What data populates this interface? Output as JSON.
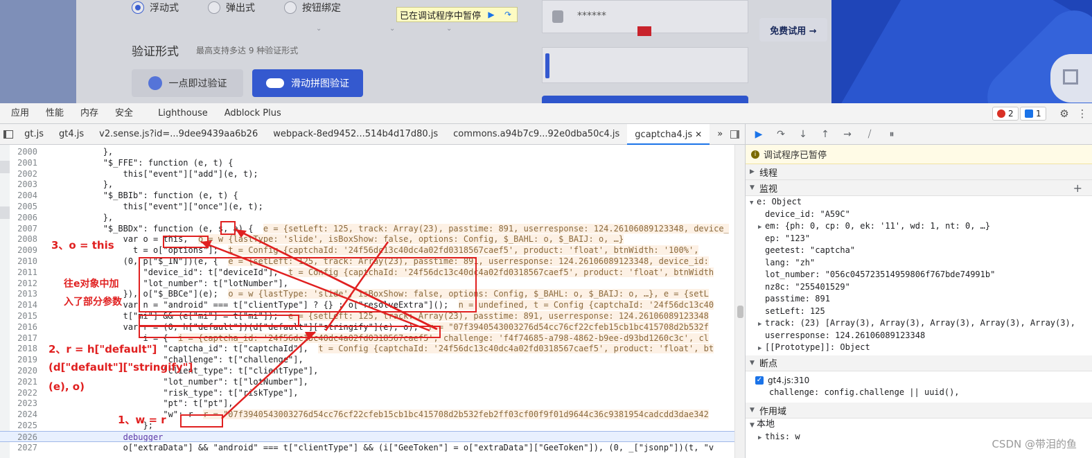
{
  "page": {
    "radio_options": [
      {
        "label": "浮动式",
        "selected": true
      },
      {
        "label": "弹出式",
        "selected": false
      },
      {
        "label": "按钮绑定",
        "selected": false
      }
    ],
    "section_title": "验证形式",
    "section_subtitle": "最高支持多达 9 种验证形式",
    "btn_one_click": "一点即过验证",
    "btn_slide": "滑动拼图验证",
    "paused_banner": "已在调试程序中暂停",
    "password_mask": "******",
    "free_trial": "免费试用 →",
    "accent_color": "#3459cf"
  },
  "devtools": {
    "panel_tabs": [
      "应用",
      "性能",
      "内存",
      "安全",
      "Lighthouse",
      "Adblock Plus"
    ],
    "error_count": "2",
    "message_count": "1",
    "file_tabs": [
      "gt.js",
      "gt4.js",
      "v2.sense.js?id=...9dee9439aa6b26",
      "webpack-8ed9452...514b4d17d80.js",
      "commons.a94b7c9...92e0dba50c4.js",
      "gcaptcha4.js"
    ],
    "active_file_tab": "gcaptcha4.js",
    "code_lines": [
      {
        "num": "2000",
        "code": "            },",
        "inline": ""
      },
      {
        "num": "2001",
        "code": "            \"$_FFE\": function (e, t) {",
        "inline": ""
      },
      {
        "num": "2002",
        "code": "                this[\"event\"][\"add\"](e, t);",
        "inline": ""
      },
      {
        "num": "2003",
        "code": "            },",
        "inline": ""
      },
      {
        "num": "2004",
        "code": "            \"$_BBIb\": function (e, t) {",
        "inline": ""
      },
      {
        "num": "2005",
        "code": "                this[\"event\"][\"once\"](e, t);",
        "inline": ""
      },
      {
        "num": "2006",
        "code": "            },",
        "inline": ""
      },
      {
        "num": "2007",
        "code": "            \"$_BBDx\": function (e, s, a) {  ",
        "inline": "e = {setLeft: 125, track: Array(23), passtime: 891, userresponse: 124.26106089123348, device_"
      },
      {
        "num": "2008",
        "code": "                var o = this,  ",
        "inline": "o = w {lastType: 'slide', isBoxShow: false, options: Config, $_BAHL: o, $_BAIJ: o, …}"
      },
      {
        "num": "2009",
        "code": "                  t = o[\"options\"];  ",
        "inline": "t = Config {captchaId: '24f56dc13c40dc4a02fd0318567caef5', product: 'float', btnWidth: '100%',"
      },
      {
        "num": "2010",
        "code": "                (0, p[\"$_IN\"])(e, {  ",
        "inline": "e = {setLeft: 125, track: Array(23), passtime: 891, userresponse: 124.26106089123348, device_id:"
      },
      {
        "num": "2011",
        "code": "                    \"device_id\": t[\"deviceId\"],  ",
        "inline": "t = Config {captchaId: '24f56dc13c40dc4a02fd0318567caef5', product: 'float', btnWidth"
      },
      {
        "num": "2012",
        "code": "                    \"lot_number\": t[\"lotNumber\"],",
        "inline": ""
      },
      {
        "num": "2013",
        "code": "                }), o[\"$_BBCe\"](e);  ",
        "inline": "o = w {lastType: 'slide', isBoxShow: false, options: Config, $_BAHL: o, $_BAIJ: o, …}, e = {setL"
      },
      {
        "num": "2014",
        "code": "                var n = \"android\" === t[\"clientType\"] ? {} : o[\"resolveExtra\"]();  ",
        "inline": "n = undefined, t = Config {captchaId: '24f56dc13c40"
      },
      {
        "num": "2015",
        "code": "                t[\"mi\"] && (e[\"mi\"] = t[\"mi\"]);  ",
        "inline": "e = {setLeft: 125, track: Array(23), passtime: 891, userresponse: 124.26106089123348"
      },
      {
        "num": "2016",
        "code": "                var r = (0, h[\"default\"])(d[\"default\"][\"stringify\"](e), o),  ",
        "inline": "r = \"07f3940543003276d54cc76cf22cfeb15cb1bc415708d2b532f"
      },
      {
        "num": "2017",
        "code": "                    i = {  ",
        "inline": "i = {captcha_id: '24f56dc13c40dc4a02fd0318567caef5', challenge: 'f4f74685-a798-4862-b9ee-d93bd1260c3c', cl"
      },
      {
        "num": "2018",
        "code": "                        \"captcha_id\": t[\"captchaId\"],  ",
        "inline": "t = Config {captchaId: '24f56dc13c40dc4a02fd0318567caef5', product: 'float', bt"
      },
      {
        "num": "2019",
        "code": "                        \"challenge\": t[\"challenge\"],",
        "inline": ""
      },
      {
        "num": "2020",
        "code": "                        \"client_type\": t[\"clientType\"],",
        "inline": ""
      },
      {
        "num": "2021",
        "code": "                        \"lot_number\": t[\"lotNumber\"],",
        "inline": ""
      },
      {
        "num": "2022",
        "code": "                        \"risk_type\": t[\"riskType\"],",
        "inline": ""
      },
      {
        "num": "2023",
        "code": "                        \"pt\": t[\"pt\"],",
        "inline": ""
      },
      {
        "num": "2024",
        "code": "                        \"w\": r  ",
        "inline": "r = \"07f3940543003276d54cc76cf22cfeb15cb1bc415708d2b532feb2ff03cf00f9f01d9644c36c9381954cadcdd3dae342"
      },
      {
        "num": "2025",
        "code": "                    };",
        "inline": ""
      },
      {
        "num": "2026",
        "code": "                debugger",
        "inline": ""
      },
      {
        "num": "2027",
        "code": "                o[\"extraData\"] && \"android\" === t[\"clientType\"] && (i[\"GeeToken\"] = o[\"extraData\"][\"GeeToken\"]), (0, _[\"jsonp\"])(t, \"v",
        "inline": ""
      }
    ],
    "annotations": {
      "note3": "3、o = this",
      "note_add_line1": "往e对象中加",
      "note_add_line2": "入了部分参数",
      "note2_line1": "2、r = h[\"default\"]",
      "note2_line2": "(d[\"default\"][\"stringify\"]",
      "note2_line3": "(e), o)",
      "note1": "1、w = r",
      "color": "#e02020"
    },
    "sidebar": {
      "paused_message": "调试程序已暂停",
      "threads_label": "线程",
      "watch_label": "监视",
      "watch_rows": [
        "e: Object",
        "device_id: \"A59C\"",
        "em: {ph: 0, cp: 0, ek: '11', wd: 1, nt: 0, …}",
        "ep: \"123\"",
        "geetest: \"captcha\"",
        "lang: \"zh\"",
        "lot_number: \"056c045723514959806f767bde74991b\"",
        "nz8c: \"255401529\"",
        "passtime: 891",
        "setLeft: 125",
        "track: (23) [Array(3), Array(3), Array(3), Array(3), Array(3),",
        "userresponse: 124.26106089123348",
        "[[Prototype]]: Object"
      ],
      "breakpoints_label": "断点",
      "breakpoint_file": "gt4.js:310",
      "breakpoint_code": "challenge: config.challenge || uuid(),",
      "scope_label": "作用域",
      "scope_local": "本地",
      "scope_this": "this: w"
    },
    "watermark": "CSDN @带泪的鱼"
  }
}
